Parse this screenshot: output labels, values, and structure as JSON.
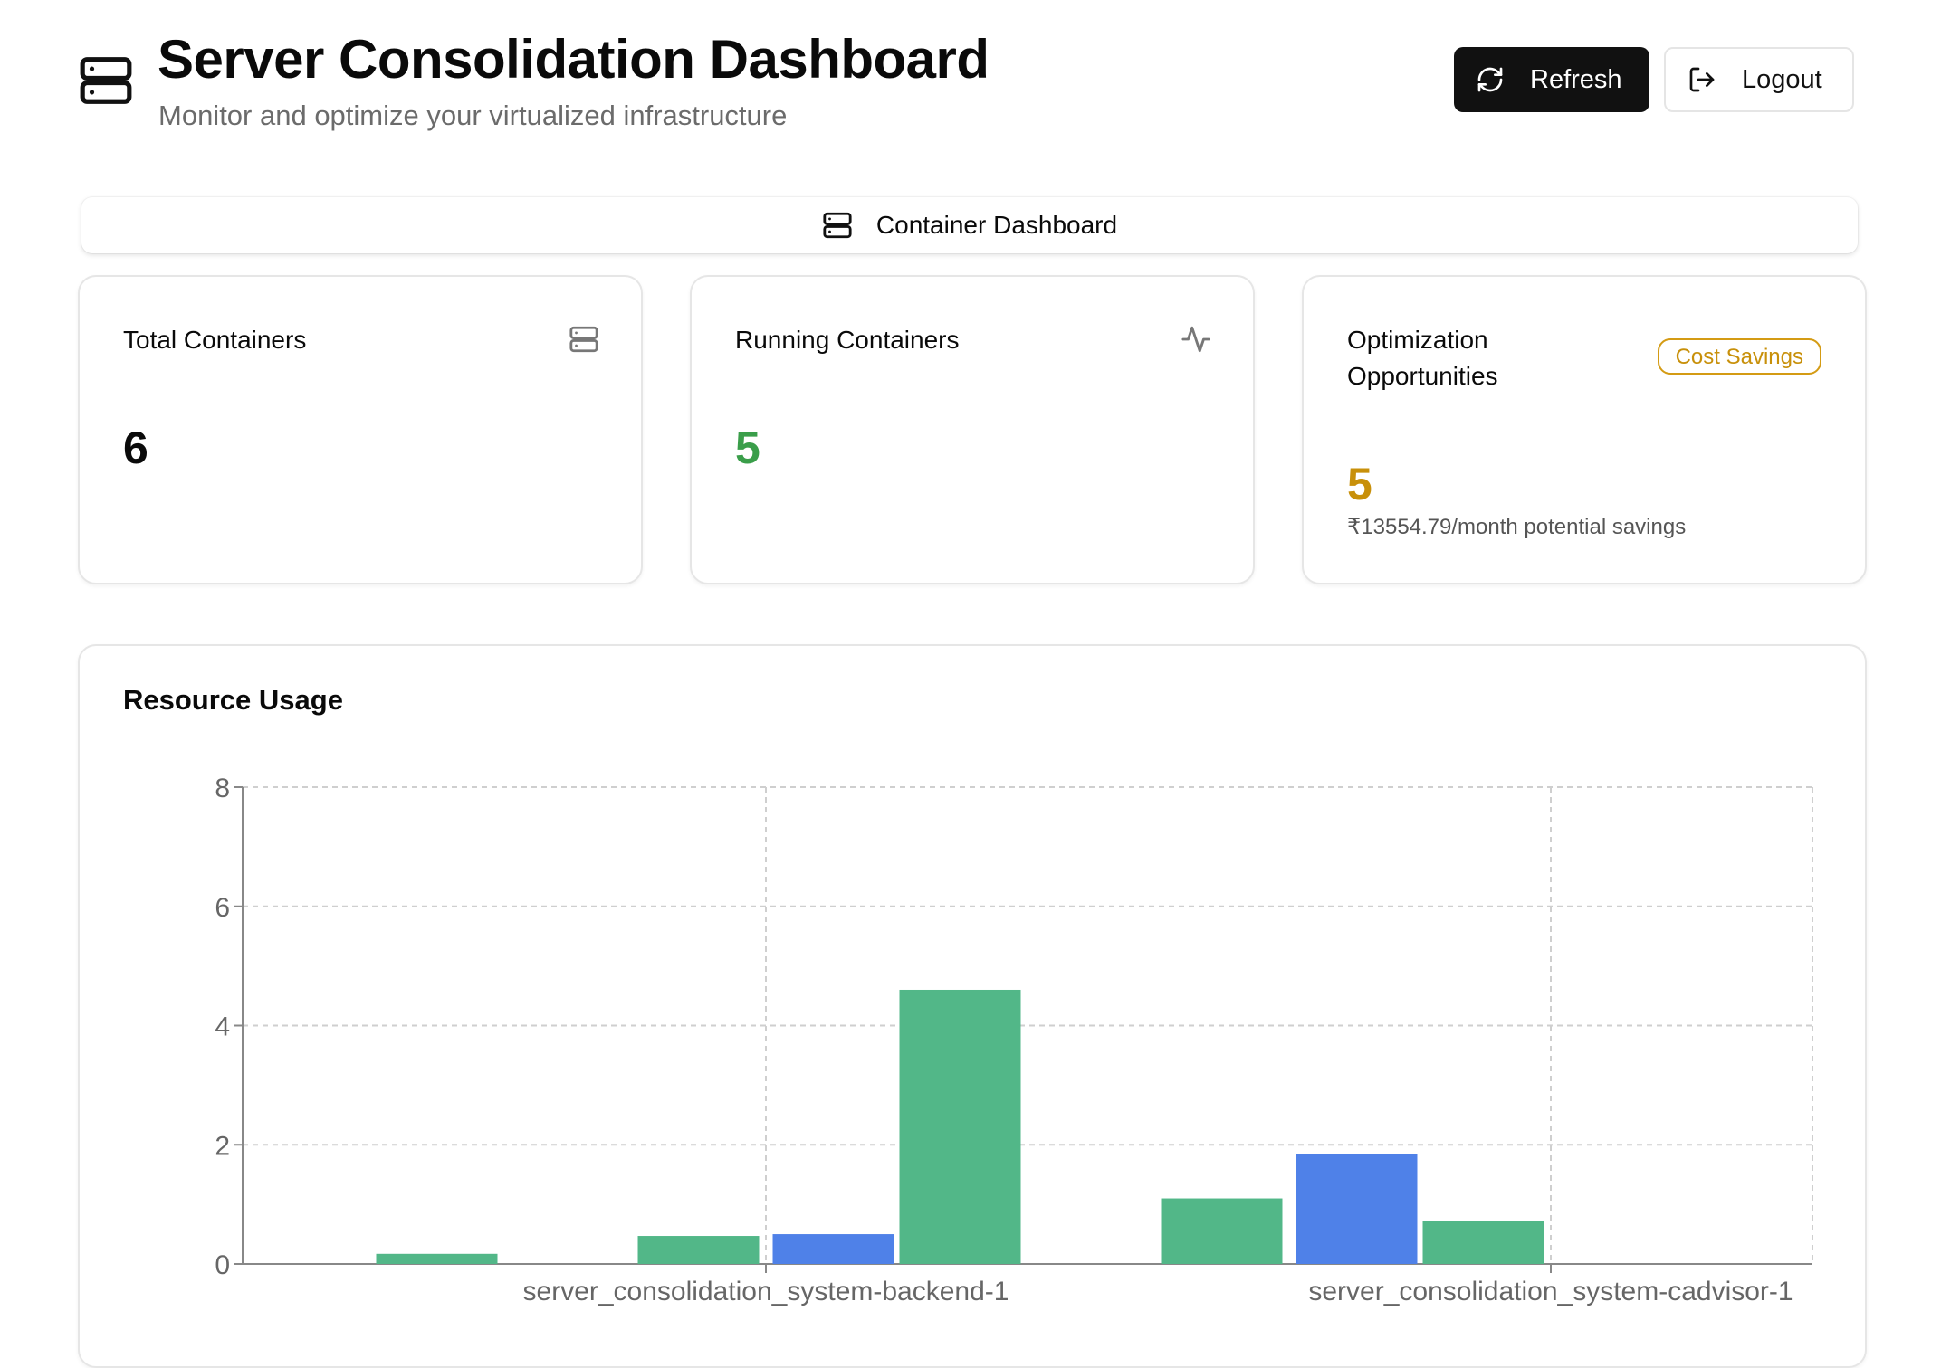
{
  "header": {
    "title": "Server Consolidation Dashboard",
    "subtitle": "Monitor and optimize your virtualized infrastructure",
    "refresh_label": "Refresh",
    "logout_label": "Logout"
  },
  "tabs": [
    {
      "label": "Container Dashboard",
      "icon": "server-icon",
      "active": true
    }
  ],
  "stats": {
    "total": {
      "label": "Total Containers",
      "value": "6",
      "icon": "server-icon"
    },
    "running": {
      "label": "Running Containers",
      "value": "5",
      "icon": "activity-icon",
      "color": "#3a9e4a"
    },
    "optimization": {
      "label_line1": "Optimization",
      "label_line2": "Opportunities",
      "badge": "Cost Savings",
      "value": "5",
      "savings": "₹13554.79/month potential savings",
      "color": "#c8900a"
    }
  },
  "resource_usage": {
    "title": "Resource Usage"
  },
  "colors": {
    "green": "#52b788",
    "blue": "#4f81e8"
  },
  "chart_data": {
    "type": "bar",
    "categories": [
      "",
      "server_consolidation_system-backend-1",
      "",
      "",
      "server_consolidation_system-cadvisor-1",
      ""
    ],
    "series": [
      {
        "color": "#4f81e8",
        "values": [
          0,
          0,
          0.5,
          0,
          1.85,
          0
        ]
      },
      {
        "color": "#52b788",
        "values": [
          0.17,
          0.47,
          4.6,
          1.1,
          0.72,
          0
        ]
      }
    ],
    "ylim": [
      0,
      8
    ],
    "yticks": [
      0,
      2,
      4,
      6,
      8
    ],
    "grid": true
  }
}
